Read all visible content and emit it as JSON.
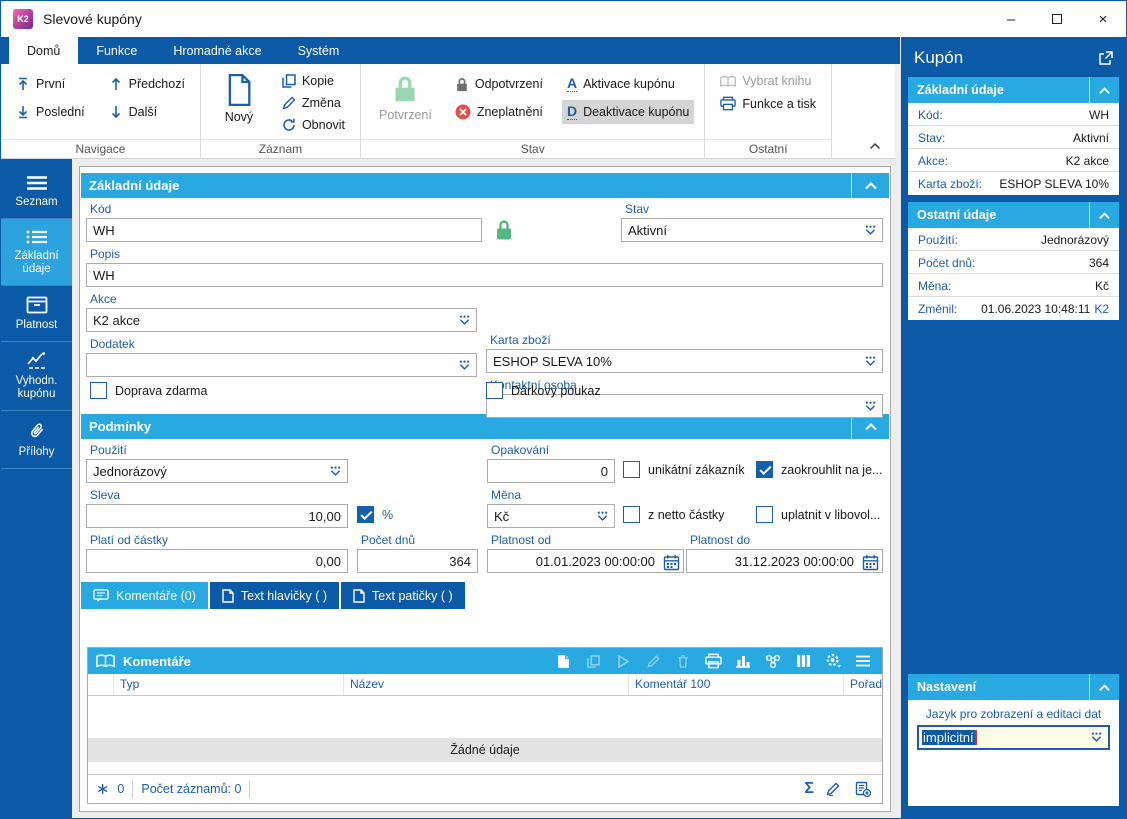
{
  "colors": {
    "accent_blue": "#0B5AA7",
    "header_cyan": "#29A9E1",
    "label_blue": "#1E5EA8",
    "lock_green": "#7CCB9B",
    "invalid_red": "#E4504E"
  },
  "window": {
    "title": "Slevové kupóny",
    "logo_text": "K2",
    "minimize": "–",
    "close": "×"
  },
  "ribbon": {
    "tabs": [
      {
        "label": "Domů"
      },
      {
        "label": "Funkce"
      },
      {
        "label": "Hromadné akce"
      },
      {
        "label": "Systém"
      }
    ],
    "nav": {
      "group": "Navigace",
      "first": "První",
      "last": "Poslední",
      "prev": "Předchozí",
      "next": "Další"
    },
    "zaznam": {
      "group": "Záznam",
      "new": "Nový",
      "copy": "Kopie",
      "change": "Změna",
      "refresh": "Obnovit"
    },
    "stav": {
      "group": "Stav",
      "confirm": "Potvrzení",
      "unconfirm": "Odpotvrzení",
      "invalidate": "Zneplatnění",
      "activate": "Aktivace kupónu",
      "deactivate": "Deaktivace kupónu",
      "activate_letter": "A",
      "deactivate_letter": "D"
    },
    "ostatni": {
      "group": "Ostatní",
      "select_book": "Vybrat knihu",
      "functions_print": "Funkce a tisk"
    }
  },
  "sidebar": {
    "items": [
      {
        "label": "Seznam"
      },
      {
        "label": "Základní údaje"
      },
      {
        "label": "Platnost"
      },
      {
        "label": "Vyhodn. kupónu"
      },
      {
        "label": "Přílohy"
      }
    ]
  },
  "form": {
    "basic": {
      "title": "Základní údaje",
      "kod": {
        "label": "Kód",
        "value": "WH"
      },
      "stav": {
        "label": "Stav",
        "value": "Aktivní"
      },
      "popis": {
        "label": "Popis",
        "value": "WH"
      },
      "akce": {
        "label": "Akce",
        "value": "K2 akce"
      },
      "karta": {
        "label": "Karta zboží",
        "value": "ESHOP SLEVA 10%"
      },
      "dodatek": {
        "label": "Dodatek",
        "value": ""
      },
      "kontakt": {
        "label": "Kontaktní osoba",
        "value": ""
      },
      "doprava": {
        "label": "Doprava zdarma",
        "checked": false
      },
      "darkovy": {
        "label": "Dárkový poukaz",
        "checked": false
      }
    },
    "podminky": {
      "title": "Podmínky",
      "pouziti": {
        "label": "Použití",
        "value": "Jednorázový"
      },
      "opakovani": {
        "label": "Opakování",
        "value": "0"
      },
      "unikatni": {
        "label": "unikátní zákazník",
        "checked": false
      },
      "zaokrouhlit": {
        "label": "zaokrouhlit na je...",
        "checked": true
      },
      "sleva": {
        "label": "Sleva",
        "value": "10,00"
      },
      "procento": {
        "label": "%",
        "checked": true
      },
      "mena": {
        "label": "Měna",
        "value": "Kč"
      },
      "znetto": {
        "label": "z netto částky",
        "checked": false
      },
      "uplatnit": {
        "label": "uplatnit v libovol...",
        "checked": false
      },
      "plati_od": {
        "label": "Platí od částky",
        "value": "0,00"
      },
      "pocet_dnu": {
        "label": "Počet dnů",
        "value": "364"
      },
      "platnost_od": {
        "label": "Platnost od",
        "value": "01.01.2023 00:00:00"
      },
      "platnost_do": {
        "label": "Platnost do",
        "value": "31.12.2023 00:00:00"
      }
    },
    "tabs": [
      {
        "label": "Komentáře (0)"
      },
      {
        "label": "Text hlavičky ( )"
      },
      {
        "label": "Text patičky ( )"
      }
    ],
    "grid": {
      "title": "Komentáře",
      "columns": [
        "Typ",
        "Název",
        "Komentář 100",
        "Pořadí"
      ],
      "empty_text": "Žádné údaje",
      "footer": {
        "flag_count": "0",
        "records": "Počet záznamů: 0",
        "sum_symbol": "Σ"
      }
    }
  },
  "panel": {
    "title": "Kupón",
    "zakladni": {
      "title": "Základní údaje",
      "rows": [
        {
          "label": "Kód:",
          "value": "WH"
        },
        {
          "label": "Stav:",
          "value": "Aktivní"
        },
        {
          "label": "Akce:",
          "value": "K2 akce"
        },
        {
          "label": "Karta zboží:",
          "value": "ESHOP SLEVA 10%"
        }
      ]
    },
    "ostatni": {
      "title": "Ostatní údaje",
      "rows": [
        {
          "label": "Použití:",
          "value": "Jednorázový"
        },
        {
          "label": "Počet dnů:",
          "value": "364"
        },
        {
          "label": "Měna:",
          "value": "Kč"
        },
        {
          "label": "Změnil:",
          "value": "01.06.2023 10:48:11",
          "suffix": "K2"
        }
      ]
    },
    "nastaveni": {
      "title": "Nastavení",
      "label": "Jazyk pro zobrazení a editaci dat",
      "value": "implicitní"
    }
  }
}
